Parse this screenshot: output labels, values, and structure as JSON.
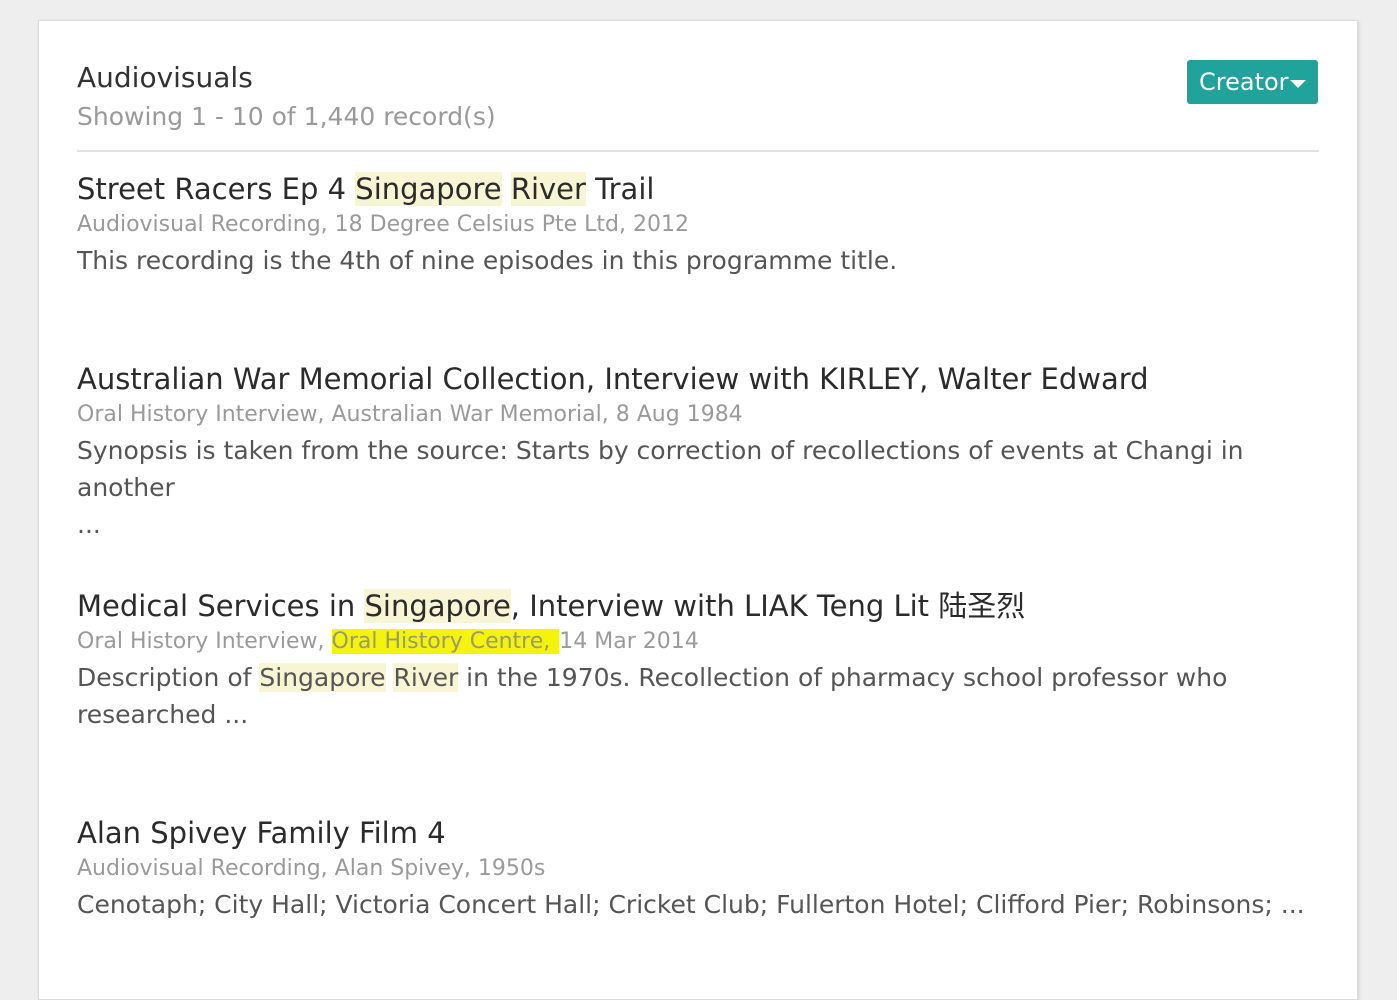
{
  "header": {
    "title": "Audiovisuals",
    "count": "Showing 1 - 10 of 1,440 record(s)",
    "creator_button": "Creator"
  },
  "results": [
    {
      "title_parts": [
        "Street Racers Ep 4 ",
        "Singapore",
        " ",
        "River",
        " Trail"
      ],
      "meta": "Audiovisual Recording, 18 Degree Celsius Pte Ltd, 2012",
      "desc": "This recording is the 4th of nine episodes in this programme title."
    },
    {
      "title": "Australian War Memorial Collection, Interview with KIRLEY, Walter Edward",
      "meta": "Oral History Interview, Australian War Memorial, 8 Aug 1984",
      "desc_line1": "Synopsis is taken from the source: Starts by correction of recollections of events at Changi in another",
      "desc_line2": "..."
    },
    {
      "title_parts": [
        "Medical Services in ",
        "Singapore",
        ", Interview with LIAK Teng Lit ",
        "陆圣烈"
      ],
      "meta_parts": [
        "Oral History Interview, ",
        "Oral History Centre, ",
        "14 Mar 2014"
      ],
      "desc_parts": [
        "Description of ",
        "Singapore",
        " ",
        "River",
        " in the 1970s. Recollection of pharmacy school professor who"
      ],
      "desc_line2": "researched ..."
    },
    {
      "title": "Alan Spivey Family Film 4",
      "meta": "Audiovisual Recording, Alan Spivey, 1950s",
      "desc": "Cenotaph; City Hall; Victoria Concert Hall; Cricket Club; Fullerton Hotel; Clifford Pier; Robinsons; ..."
    }
  ],
  "colors": {
    "accent": "#1fa39a",
    "highlight": "#f7f5d4",
    "marker": "#f3f40a"
  },
  "icons": {
    "creator_caret": "caret-down-icon"
  }
}
